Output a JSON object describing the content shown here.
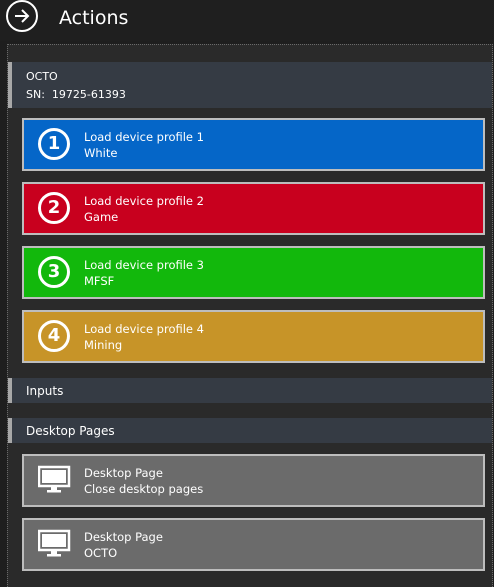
{
  "header": {
    "title": "Actions",
    "nav_icon": "arrow-right-circle-icon"
  },
  "device": {
    "name": "OCTO",
    "sn": "SN:  19725-61393"
  },
  "profiles": [
    {
      "number": "1",
      "line1": "Load device profile 1",
      "line2": "White",
      "color": "#0566c8"
    },
    {
      "number": "2",
      "line1": "Load device profile 2",
      "line2": "Game",
      "color": "#c8001e"
    },
    {
      "number": "3",
      "line1": "Load device profile 3",
      "line2": "MFSF",
      "color": "#12b80c"
    },
    {
      "number": "4",
      "line1": "Load device profile 4",
      "line2": "Mining",
      "color": "#c79428"
    }
  ],
  "sections": {
    "inputs": "Inputs",
    "desktop_pages": "Desktop Pages"
  },
  "desktop_pages": [
    {
      "line1": "Desktop Page",
      "line2": "Close desktop pages",
      "icon": "monitor-icon",
      "color": "#6b6b6b"
    },
    {
      "line1": "Desktop Page",
      "line2": "OCTO",
      "icon": "monitor-icon",
      "color": "#6b6b6b"
    }
  ]
}
